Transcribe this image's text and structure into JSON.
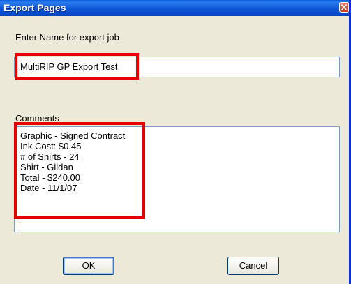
{
  "window": {
    "title": "Export Pages"
  },
  "job_name": {
    "label": "Enter Name for export job",
    "value": "MultiRIP GP Export Test"
  },
  "comments": {
    "label": "Comments",
    "lines": [
      "Graphic - Signed Contract",
      "Ink Cost: $0.45",
      "# of Shirts - 24",
      "Shirt - Gildan",
      "Total - $240.00",
      "Date - 11/1/07"
    ]
  },
  "buttons": {
    "ok_label": "OK",
    "cancel_label": "Cancel"
  },
  "colors": {
    "highlight": "#e60000",
    "titlebar": "#0a4bcc",
    "dialog_face": "#ece9d8"
  },
  "icons": {
    "close": "close-icon"
  }
}
